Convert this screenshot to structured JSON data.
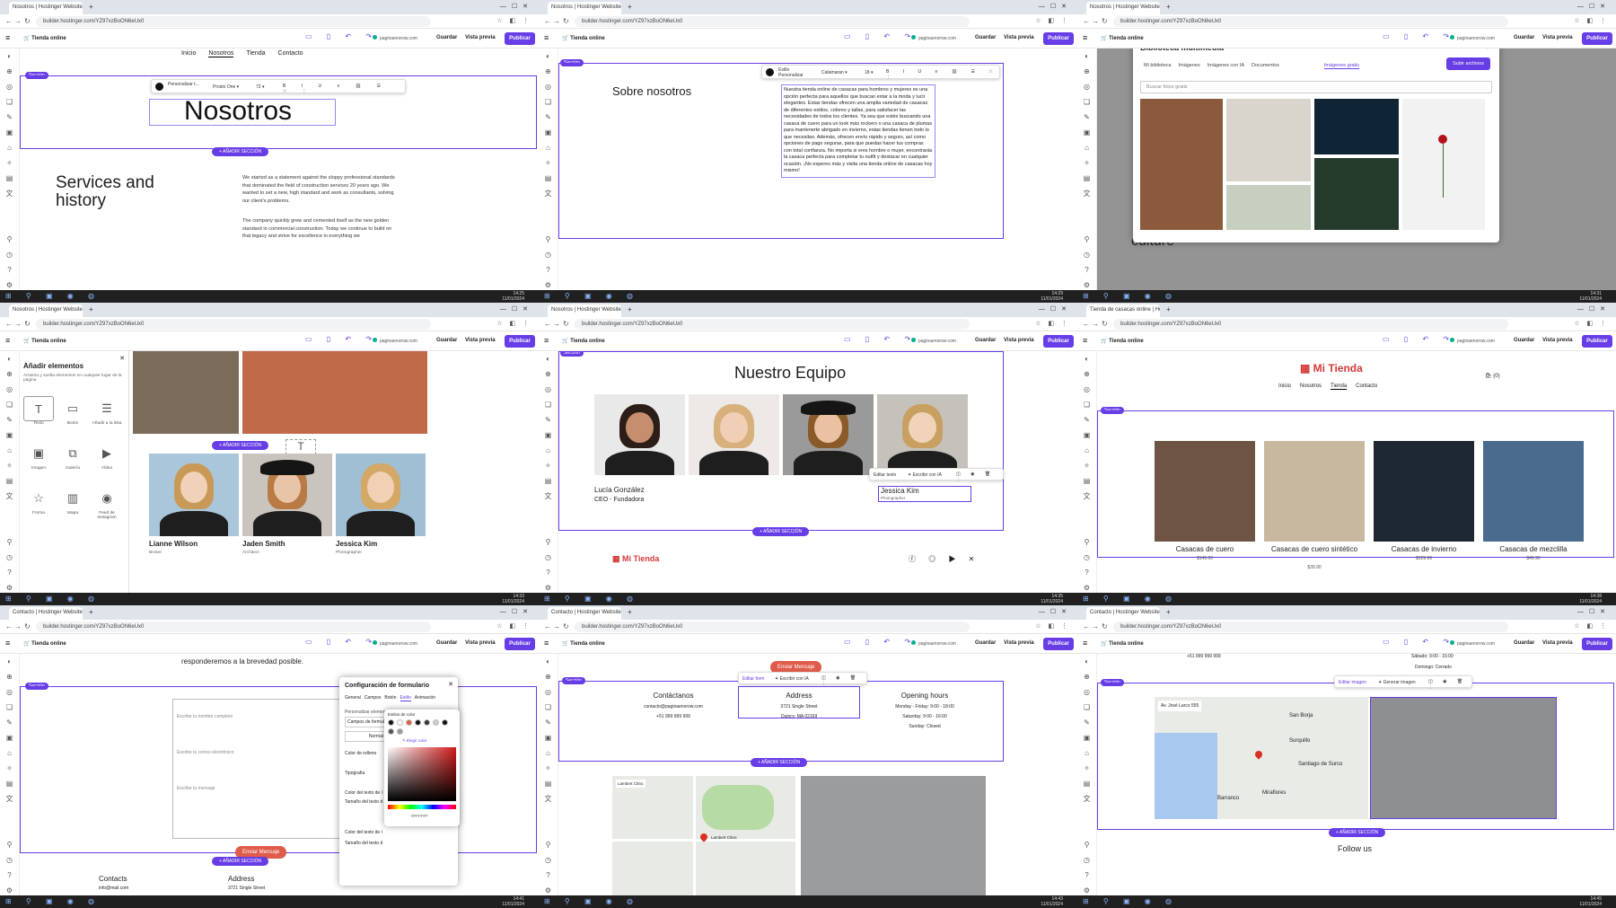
{
  "common": {
    "url": "builder.hostinger.com/YZ97xzBoON6eUx0",
    "store_name": "Tienda online",
    "domain": "paginaenorow.com",
    "save_label": "Guardar",
    "preview_label": "Vista previa",
    "publish_label": "Publicar",
    "add_section_label": "+ AÑADIR SECCIÓN",
    "section_badge": "Sección"
  },
  "panels": [
    {
      "tab_title": "Nosotros | Hostinger Website",
      "time": "14:25",
      "date": "11/01/2024",
      "nav_items": [
        "Inicio",
        "Nosotros",
        "Tienda",
        "Contacto"
      ],
      "heading": "Nosotros",
      "fmt_toolbar": {
        "color_label": "Texto",
        "font": "Prosto One",
        "size": "72",
        "style": "Personalizar t..."
      },
      "left_title": "Services and history",
      "paragraph_1": "We started as a statement against the sloppy professional standards that dominated the field of construction services 20 years ago. We wanted to set a new, high standard and work as consultants, solving our client's problems.",
      "paragraph_2": "The company quickly grew and cemented itself as the new golden standard in commercial construction. Today we continue to build on that legacy and strive for excellence in everything we"
    },
    {
      "tab_title": "Nosotros | Hostinger Website",
      "time": "14:29",
      "date": "11/01/2024",
      "heading": "Sobre nosotros",
      "fmt_toolbar": {
        "style": "Estilo Personalizar",
        "font": "Catamaran",
        "size": "18"
      },
      "body": "Nuestra tienda online de casacas para hombres y mujeres es una opción perfecta para aquellos que buscan estar a la moda y lucir elegantes. Estas tiendas ofrecen una amplia variedad de casacas de diferentes estilos, colores y tallas, para satisfacer las necesidades de todos los clientes. Ya sea que estés buscando una casaca de cuero para un look más rockero o una casaca de plumas para mantenerte abrigado en invierno, estas tiendas tienen todo lo que necesitas. Además, ofrecen envío rápido y seguro, así como opciones de pago seguras, para que puedas hacer tus compras con total confianza. No importa si eres hombre o mujer, encontrarás la casaca perfecta para completar tu outfit y destacar en cualquier ocasión. ¡No esperes más y visita una tienda online de casacas hoy mismo!"
    },
    {
      "tab_title": "Nosotros | Hostinger Website",
      "time": "14:31",
      "date": "11/01/2024",
      "modal_title": "Biblioteca multimedia",
      "modal_tabs": [
        "Mi biblioteca",
        "Imágenes",
        "Imágenes con IA",
        "Documentos",
        "Imágenes gratis"
      ],
      "upload_label": "Subir archivos",
      "search_placeholder": "Buscar fotos gratis",
      "bg_text": "culture",
      "colors": {
        "img1": "#8b5a3c",
        "img2": "#d9d4cc",
        "img3": "#0f2535",
        "img4": "#243a2b",
        "img5": "#f2f2f2"
      }
    },
    {
      "tab_title": "Nosotros | Hostinger Website",
      "time": "14:33",
      "date": "11/01/2024",
      "drawer_title": "Añadir elementos",
      "drawer_subtitle": "Arrastra y suelta elementos en cualquier lugar de la página",
      "elements": [
        "Texto",
        "Botón",
        "Añadir a la lista",
        "Imagen",
        "Galería",
        "Vídeo",
        "Forma",
        "Mapa",
        "Feed de Instagram"
      ],
      "drag_label": "Texto",
      "people": [
        {
          "name": "Lianne Wilson",
          "role": "Broker"
        },
        {
          "name": "Jaden Smith",
          "role": "Architect"
        },
        {
          "name": "Jessica Kim",
          "role": "Photographer"
        }
      ]
    },
    {
      "tab_title": "Nosotros | Hostinger Website",
      "time": "14:35",
      "date": "11/01/2024",
      "heading": "Nuestro Equipo",
      "person_name": "Lucía González",
      "person_role": "CEO - Fundadora",
      "selected_name": "Jessica Kim",
      "selected_role": "Photographer",
      "edit_text": "Editar texto",
      "ai_write": "Escribir con IA",
      "footer_brand": "Mi Tienda"
    },
    {
      "tab_title": "Tienda de casacas online | Hos",
      "time": "14:38",
      "date": "11/01/2024",
      "brand": "Mi Tienda",
      "nav_items": [
        "Inicio",
        "Nosotros",
        "Tienda",
        "Contacto"
      ],
      "cart_count": "(0)",
      "products": [
        {
          "name": "Casacas de cuero",
          "price": "$149.00"
        },
        {
          "name": "Casacas de cuero sintético",
          "price": "$39.90"
        },
        {
          "name": "Casacas de invierno",
          "price": "$129.99"
        },
        {
          "name": "Casacas de mezclilla",
          "price": "$49.90"
        }
      ]
    },
    {
      "tab_title": "Contacto | Hostinger Website",
      "time": "14:41",
      "date": "11/01/2024",
      "top_text": "responderemos a la brevedad posible.",
      "field_name": "Escribe tu nombre completo",
      "field_email": "Escribe tu correo electrónico",
      "field_msg": "Escribe tu mensaje",
      "send_label": "Enviar Mensaje",
      "contacts_title": "Contacts",
      "contacts_email": "info@mail.com",
      "address_title": "Address",
      "address_line": "3721 Single Street",
      "settings_title": "Configuración de formulario",
      "settings_tabs": [
        "General",
        "Campos",
        "Botón",
        "Estilo",
        "Animación"
      ],
      "customize_label": "Personalizar elementos",
      "fields_select": "Campos de formulario",
      "state": "Normal",
      "fill_label": "Color de relleno",
      "typo_label": "Tipografía",
      "color_text_label": "Color del texto de l",
      "size_text_label": "Tamaño del texto d",
      "color_styles": "Estilos de color",
      "pick_color": "Elegir color",
      "hex": "#FFFFFF"
    },
    {
      "tab_title": "Contacto | Hostinger Website",
      "time": "14:43",
      "date": "11/01/2024",
      "send_label": "Enviar Mensaje",
      "edit_form": "Editar form",
      "ai_write": "Escribir con IA",
      "col1_title": "Contáctanos",
      "col1_lines": [
        "contacto@paginaenorow.com",
        "+51 999 999 999"
      ],
      "col2_title": "Address",
      "col2_lines": [
        "3721 Single Street",
        "Quincy, MA 02169"
      ],
      "col3_title": "Opening hours",
      "col3_lines": [
        "Monday - Friday: 9:00 - 18:00",
        "Saturday: 9:00 - 16:00",
        "Sunday: Closed"
      ],
      "map_place": "Lambert Clinic",
      "map_label": "Lambert Clinic"
    },
    {
      "tab_title": "Contacto | Hostinger Website",
      "time": "14:45",
      "date": "11/01/2024",
      "phone": "+51 999 999 999",
      "hours_sat": "Sábado: 9:00 - 16:00",
      "hours_sun": "Domingo: Cerrado",
      "edit_image": "Editar imagen",
      "remove_image": "Generar imagen",
      "map_places": [
        "San Borja",
        "Surquillo",
        "Santiago de Surco",
        "Miraflores",
        "Barranco"
      ],
      "map_card": "Av. José Larco 555",
      "follow_title": "Follow us"
    }
  ]
}
